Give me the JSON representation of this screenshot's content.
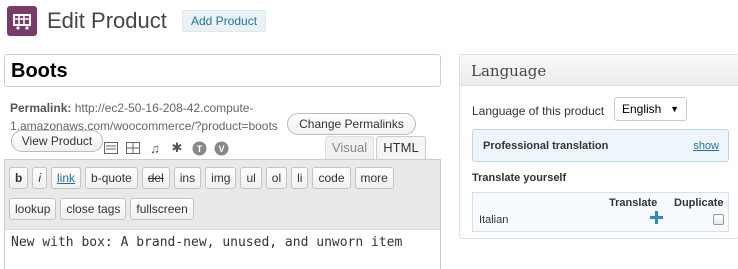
{
  "header": {
    "title": "Edit Product",
    "add_label": "Add Product",
    "icon": "cart-icon",
    "accent": "#7a3b6b"
  },
  "title_field": {
    "value": "Boots"
  },
  "permalink": {
    "label": "Permalink:",
    "url": "http://ec2-50-16-208-42.compute-1.amazonaws.com/woocommerce/?product=boots",
    "change_label": "Change Permalinks",
    "view_label": "View Product"
  },
  "media_icons": [
    "image-icon",
    "gallery-icon",
    "video-icon",
    "audio-icon",
    "media-icon",
    "wordpress-icon",
    "vimeo-icon"
  ],
  "editor": {
    "tabs": {
      "visual": "Visual",
      "html": "HTML"
    },
    "quicktags_row1": [
      "b",
      "i",
      "link",
      "b-quote",
      "del",
      "ins",
      "img",
      "ul",
      "ol",
      "li",
      "code",
      "more"
    ],
    "quicktags_row2": [
      "lookup",
      "close tags",
      "fullscreen"
    ],
    "content": "New with box: A brand-new, unused, and unworn item"
  },
  "language_panel": {
    "title": "Language",
    "label": "Language of this product",
    "selected": "English",
    "professional_title": "Professional translation",
    "show_label": "show",
    "translate_yourself": "Translate yourself",
    "col_translate": "Translate",
    "col_duplicate": "Duplicate",
    "rows": [
      {
        "language": "Italian"
      }
    ]
  }
}
